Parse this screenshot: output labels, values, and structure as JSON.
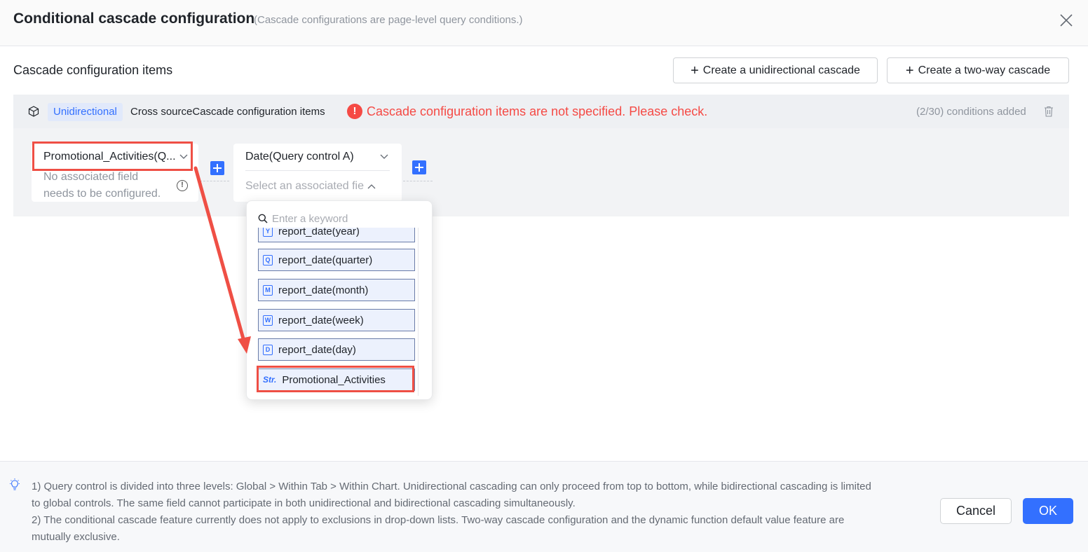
{
  "dialog": {
    "title": "Conditional cascade configuration",
    "subtitle": "(Cascade configurations are page-level query conditions.)"
  },
  "section": {
    "title": "Cascade configuration items",
    "create_unidirectional_label": "Create a unidirectional cascade",
    "create_two_way_label": "Create a two-way cascade"
  },
  "config_item": {
    "tag": "Unidirectional",
    "label": "Cross sourceCascade configuration items",
    "warning": "Cascade configuration items are not specified. Please check.",
    "count": "(2/30) conditions added"
  },
  "control_a": {
    "selected": "Promotional_Activities(Q...",
    "hint_line1": "No associated field",
    "hint_line2": "needs to be configured."
  },
  "control_b": {
    "selected": "Date(Query control A)",
    "field_placeholder": "Select an associated fie"
  },
  "dropdown": {
    "search_placeholder": "Enter a keyword",
    "items": [
      {
        "icon": "Y",
        "label": "report_date(year)"
      },
      {
        "icon": "Q",
        "label": "report_date(quarter)"
      },
      {
        "icon": "M",
        "label": "report_date(month)"
      },
      {
        "icon": "W",
        "label": "report_date(week)"
      },
      {
        "icon": "D",
        "label": "report_date(day)"
      },
      {
        "icon": "Str.",
        "label": "Promotional_Activities"
      }
    ]
  },
  "footer": {
    "note1_line1": "1) Query control is divided into three levels: Global > Within Tab > Within Chart. Unidirectional cascading can only proceed from top to bottom, while bidirectional cascading is limited",
    "note1_line2": "to global controls. The same field cannot participate in both unidirectional and bidirectional cascading simultaneously.",
    "note2_line1": "2) The conditional cascade feature currently does not apply to exclusions in drop-down lists. Two-way cascade configuration and the dynamic function default value feature are",
    "note2_line2": "mutually exclusive.",
    "cancel_label": "Cancel",
    "ok_label": "OK"
  },
  "colors": {
    "accent": "#3370ff",
    "error": "#f54a45",
    "highlight": "#ef4f45"
  }
}
